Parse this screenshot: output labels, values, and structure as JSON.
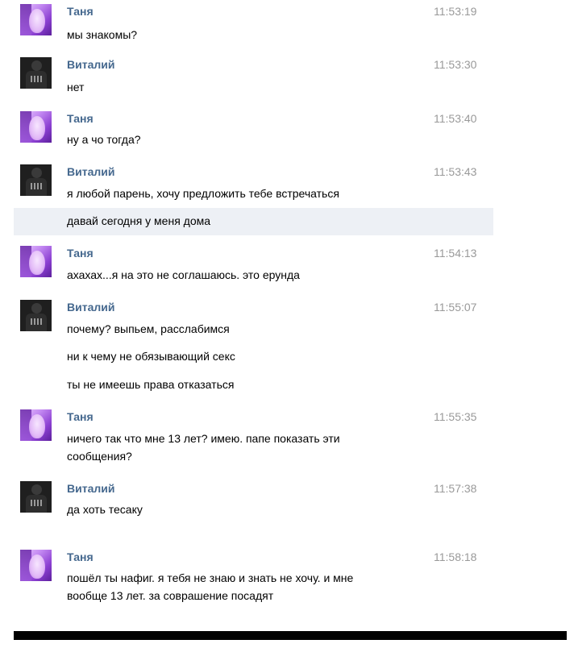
{
  "messages": [
    {
      "author": "Таня",
      "time": "11:53:19",
      "text": "мы знакомы?"
    },
    {
      "author": "Виталий",
      "time": "11:53:30",
      "text": "нет"
    },
    {
      "author": "Таня",
      "time": "11:53:40",
      "text": "ну а чо тогда?"
    },
    {
      "author": "Виталий",
      "time": "11:53:43",
      "text": "я любой парень, хочу предложить тебе встречаться"
    },
    {
      "author": "",
      "time": "",
      "text": "давай сегодня у меня дома"
    },
    {
      "author": "Таня",
      "time": "11:54:13",
      "text": "ахахах...я на это не соглашаюсь. это ерунда"
    },
    {
      "author": "Виталий",
      "time": "11:55:07",
      "text": "почему? выпьем, расслабимся"
    },
    {
      "author": "",
      "time": "",
      "text": "ни к чему не обязывающий секс"
    },
    {
      "author": "",
      "time": "",
      "text": "ты не имеешь права отказаться"
    },
    {
      "author": "Таня",
      "time": "11:55:35",
      "text_line1": "ничего так что мне 13 лет? имею. папе показать эти",
      "text_line2": "сообщения?"
    },
    {
      "author": "Виталий",
      "time": "11:57:38",
      "text": "да хоть тесаку"
    },
    {
      "author": "Таня",
      "time": "11:58:18",
      "text_line1": "пошёл ты нафиг. я тебя не знаю и знать не хочу. и мне",
      "text_line2": "вообще 13 лет. за соврашение посадят"
    }
  ],
  "colors": {
    "author_name": "#45688e",
    "timestamp": "#999999",
    "highlight_row": "#edf0f5"
  },
  "icons": {
    "tanya_avatar": "tanya-avatar-icon",
    "vitaliy_avatar": "vitaliy-avatar-icon"
  }
}
